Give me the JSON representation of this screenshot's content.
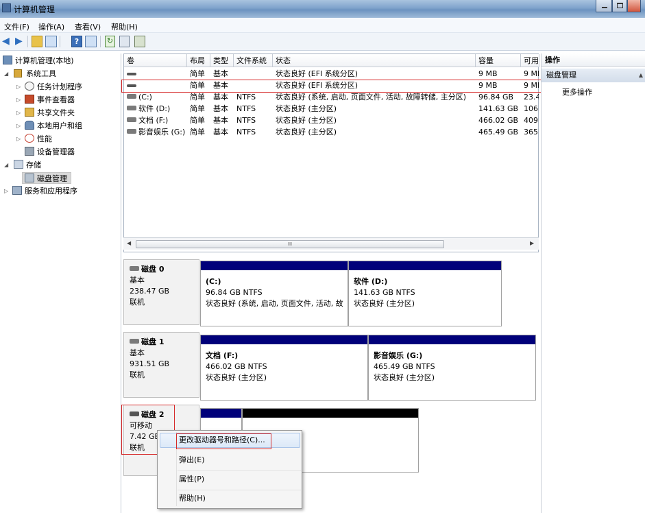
{
  "window": {
    "title": "计算机管理"
  },
  "menu": [
    "文件(F)",
    "操作(A)",
    "查看(V)",
    "帮助(H)"
  ],
  "tree": {
    "root": "计算机管理(本地)",
    "system_tools": "系统工具",
    "task_scheduler": "任务计划程序",
    "event_viewer": "事件查看器",
    "shared_folders": "共享文件夹",
    "local_users": "本地用户和组",
    "performance": "性能",
    "device_manager": "设备管理器",
    "storage": "存储",
    "disk_management": "磁盘管理",
    "services_apps": "服务和应用程序"
  },
  "volume_table": {
    "headers": [
      "卷",
      "布局",
      "类型",
      "文件系统",
      "状态",
      "容量",
      "可用"
    ],
    "rows": [
      {
        "vol": "",
        "layout": "简单",
        "type": "基本",
        "fs": "",
        "status": "状态良好 (EFI 系统分区)",
        "cap": "9 MB",
        "free": "9 MB"
      },
      {
        "vol": "",
        "layout": "简单",
        "type": "基本",
        "fs": "",
        "status": "状态良好 (EFI 系统分区)",
        "cap": "9 MB",
        "free": "9 MB"
      },
      {
        "vol": "(C:)",
        "layout": "简单",
        "type": "基本",
        "fs": "NTFS",
        "status": "状态良好 (系统, 启动, 页面文件, 活动, 故障转储, 主分区)",
        "cap": "96.84 GB",
        "free": "23.4"
      },
      {
        "vol": "软件 (D:)",
        "layout": "简单",
        "type": "基本",
        "fs": "NTFS",
        "status": "状态良好 (主分区)",
        "cap": "141.63 GB",
        "free": "106"
      },
      {
        "vol": "文档 (F:)",
        "layout": "简单",
        "type": "基本",
        "fs": "NTFS",
        "status": "状态良好 (主分区)",
        "cap": "466.02 GB",
        "free": "409"
      },
      {
        "vol": "影音娱乐 (G:)",
        "layout": "简单",
        "type": "基本",
        "fs": "NTFS",
        "status": "状态良好 (主分区)",
        "cap": "465.49 GB",
        "free": "365"
      }
    ],
    "scroll_marker": "III"
  },
  "actions": {
    "header": "操作",
    "section": "磁盘管理",
    "more": "更多操作"
  },
  "disks": [
    {
      "name": "磁盘 0",
      "kind": "基本",
      "size": "238.47 GB",
      "state": "联机",
      "parts": [
        {
          "title": "(C:)",
          "size": "96.84 GB NTFS",
          "status": "状态良好 (系统, 启动, 页面文件, 活动, 故"
        },
        {
          "title": "软件 (D:)",
          "size": "141.63 GB NTFS",
          "status": "状态良好 (主分区)"
        }
      ]
    },
    {
      "name": "磁盘 1",
      "kind": "基本",
      "size": "931.51 GB",
      "state": "联机",
      "parts": [
        {
          "title": "文档 (F:)",
          "size": "466.02 GB NTFS",
          "status": "状态良好 (主分区)"
        },
        {
          "title": "影音娱乐 (G:)",
          "size": "465.49 GB NTFS",
          "status": "状态良好 (主分区)"
        }
      ]
    },
    {
      "name": "磁盘 2",
      "kind": "可移动",
      "size": "7.42 GB",
      "state": "联机"
    }
  ],
  "context_menu": [
    "更改驱动器号和路径(C)...",
    "弹出(E)",
    "属性(P)",
    "帮助(H)"
  ],
  "colors": {
    "partition_bar": "#00007a",
    "unallocated_bar": "#000000",
    "highlight_box": "#d62a2a"
  }
}
